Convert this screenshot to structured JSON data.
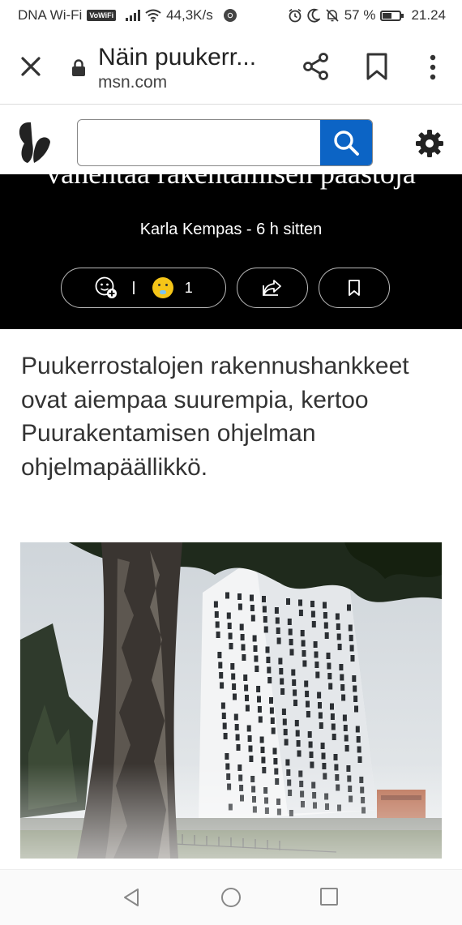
{
  "status_bar": {
    "carrier": "DNA Wi-Fi",
    "volte_badge": "VoWiFi",
    "speed": "44,3K/s",
    "battery": "57 %",
    "battery_level": 0.57,
    "time": "21.24"
  },
  "toolbar": {
    "title": "Näin puukerr...",
    "url": "msn.com",
    "icons": [
      "close-icon",
      "lock-icon",
      "share-icon",
      "bookmark-icon",
      "overflow-menu-icon"
    ]
  },
  "msn_header": {
    "search_value": "",
    "search_placeholder": "",
    "icons": [
      "msn-butterfly-logo",
      "search-icon",
      "gear-icon"
    ],
    "accent": "#0c64c5"
  },
  "article": {
    "headline_fragment": "vähentää rakentamisen päästöja",
    "byline": "Karla Kempas - 6 h sitten",
    "reaction_count": "1",
    "lede": "Puukerrostalojen rakennushankkeet ovat aiempaa suurempia, kertoo Puurakentamisen ohjelman ohjelmapäällikkö."
  },
  "nav_bar": {
    "icons": [
      "back-icon",
      "home-icon",
      "recents-icon"
    ]
  }
}
